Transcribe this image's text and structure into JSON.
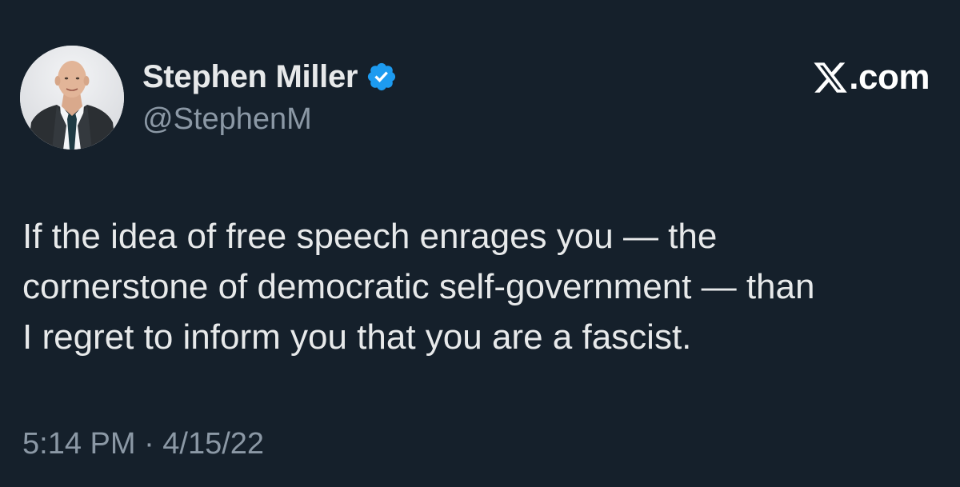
{
  "brand": {
    "text": ".com",
    "logo_icon": "x-logo-icon",
    "color": "#ffffff"
  },
  "author": {
    "display_name": "Stephen Miller",
    "handle": "@StephenM",
    "verified": true,
    "verified_icon": "verified-badge-icon",
    "verified_color": "#1d9bf0"
  },
  "tweet": {
    "lines": [
      "If the idea of free speech enrages you — the",
      "cornerstone of democratic self-government — than",
      "I regret to inform you that you are a fascist."
    ],
    "timestamp": "5:14 PM · 4/15/22"
  },
  "theme": {
    "background": "#15202b",
    "text_primary": "#e7e9ea",
    "text_secondary": "#8b98a5"
  }
}
